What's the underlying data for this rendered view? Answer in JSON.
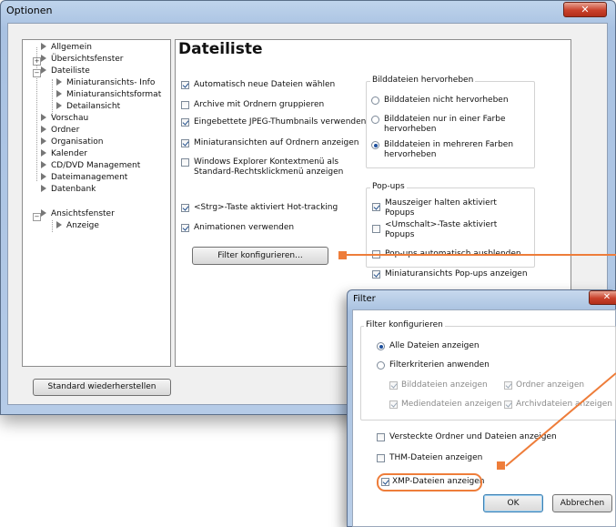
{
  "window": {
    "title": "Optionen",
    "close_glyph": "✕"
  },
  "tree": {
    "items": [
      {
        "label": "Allgemein"
      },
      {
        "label": "Übersichtsfenster"
      },
      {
        "label": "Dateiliste"
      },
      {
        "label": "Miniaturansichts- Info"
      },
      {
        "label": "Miniaturansichtsformat"
      },
      {
        "label": "Detailansicht"
      },
      {
        "label": "Vorschau"
      },
      {
        "label": "Ordner"
      },
      {
        "label": "Organisation"
      },
      {
        "label": "Kalender"
      },
      {
        "label": "CD/DVD Management"
      },
      {
        "label": "Dateimanagement"
      },
      {
        "label": "Datenbank"
      },
      {
        "label": "Ansichtsfenster"
      },
      {
        "label": "Anzeige"
      }
    ],
    "expanders": {
      "plus": "+",
      "minus": "−"
    }
  },
  "panel": {
    "title": "Dateiliste",
    "left_options": [
      {
        "label": "Automatisch neue Dateien wählen",
        "checked": true
      },
      {
        "label": "Archive mit Ordnern gruppieren",
        "checked": false
      },
      {
        "label": "Eingebettete JPEG-Thumbnails verwenden",
        "checked": true
      },
      {
        "label": "Miniaturansichten auf Ordnern anzeigen",
        "checked": true
      },
      {
        "label": "Windows Explorer Kontextmenü als",
        "label2": "Standard-Rechtsklickmenü anzeigen",
        "checked": false
      },
      {
        "label": "<Strg>-Taste aktiviert Hot-tracking",
        "checked": true
      },
      {
        "label": "Animationen verwenden",
        "checked": true
      }
    ],
    "filter_button": "Filter konfigurieren...",
    "highlight_group": {
      "title": "Bilddateien hervorheben",
      "options": [
        {
          "label": "Bilddateien nicht hervorheben",
          "selected": false
        },
        {
          "label": "Bilddateien nur in einer Farbe",
          "label2": "hervorheben",
          "selected": false
        },
        {
          "label": "Bilddateien in mehreren Farben",
          "label2": "hervorheben",
          "selected": true
        }
      ]
    },
    "popups_group": {
      "title": "Pop-ups",
      "options": [
        {
          "label": "Mauszeiger halten aktiviert",
          "label2": "Popups",
          "checked": true
        },
        {
          "label": "<Umschalt>-Taste aktiviert",
          "label2": "Popups",
          "checked": false
        },
        {
          "label": "Pop-ups automatisch ausblenden",
          "checked": false
        },
        {
          "label": "Miniaturansichts Pop-ups anzeigen",
          "checked": true
        }
      ]
    }
  },
  "restore_button": "Standard wiederherstellen",
  "filter_dialog": {
    "title": "Filter",
    "close_glyph": "✕",
    "group_title": "Filter konfigurieren",
    "radio_all": {
      "label": "Alle Dateien anzeigen",
      "selected": true
    },
    "radio_criteria": {
      "label": "Filterkriterien anwenden",
      "selected": false
    },
    "criteria": [
      {
        "label": "Bilddateien anzeigen",
        "checked": true
      },
      {
        "label": "Ordner anzeigen",
        "checked": true
      },
      {
        "label": "Mediendateien anzeigen",
        "checked": true
      },
      {
        "label": "Archivdateien anzeigen",
        "checked": true
      }
    ],
    "options": [
      {
        "label": "Versteckte Ordner und Dateien anzeigen",
        "checked": false
      },
      {
        "label": "THM-Dateien anzeigen",
        "checked": false
      },
      {
        "label": "XMP-Dateien anzeigen",
        "checked": true
      }
    ],
    "ok_button": "OK",
    "cancel_button": "Abbrechen"
  },
  "colors": {
    "annotation_orange": "#ee7d3a",
    "title_bar_blue": "#a9c2e2",
    "close_red": "#c9412b"
  }
}
